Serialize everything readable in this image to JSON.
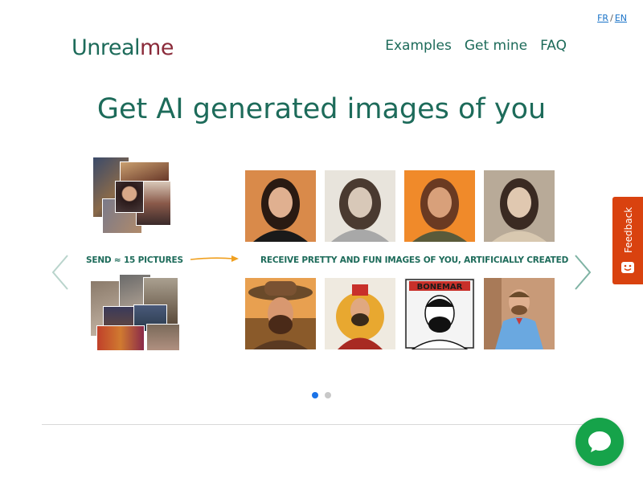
{
  "lang": {
    "fr": "FR",
    "sep": "/",
    "en": "EN"
  },
  "logo": {
    "part1": "Unreal",
    "part2": "me"
  },
  "nav": [
    "Examples",
    "Get mine",
    "FAQ"
  ],
  "hero": {
    "title": "Get AI generated images of you"
  },
  "carousel": {
    "left_caption": "SEND ≈ 15 PICTURES",
    "right_caption": "RECEIVE PRETTY AND FUN IMAGES OF YOU, ARTIFICIALLY CREATED",
    "comic_title": "BONEMAR",
    "slide_count": 2,
    "active_slide": 1
  },
  "feedback": {
    "label": "Feedback"
  },
  "colors": {
    "brand_green": "#1d6b5a",
    "brand_red": "#8b2b3a",
    "feedback": "#d9420f",
    "chat": "#16a34a",
    "arrow": "#f0a020"
  }
}
